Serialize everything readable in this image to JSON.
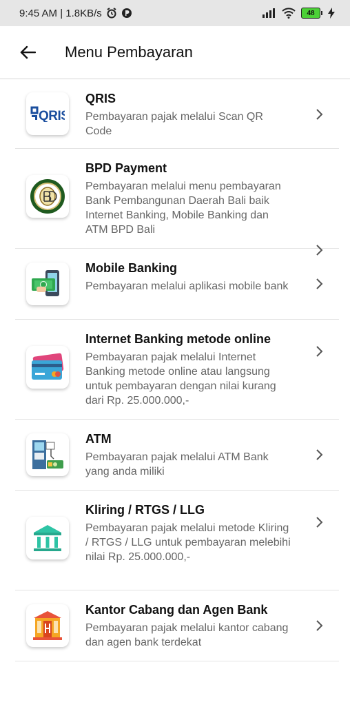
{
  "status_bar": {
    "left_text": "9:45 AM | 1.8KB/s",
    "battery": "48"
  },
  "app_bar": {
    "title": "Menu Pembayaran"
  },
  "items": [
    {
      "title": "QRIS",
      "description": "Pembayaran pajak melalui Scan QR Code",
      "icon": "qris-logo",
      "logo_text": "QRIS"
    },
    {
      "title": "BPD Payment",
      "description": "Pembayaran melalui menu pembayaran Bank Pembangunan Daerah Bali baik Internet Banking, Mobile Banking dan ATM BPD Bali",
      "icon": "bpd-bali-logo"
    },
    {
      "title": "Mobile Banking",
      "description": "Pembayaran melalui aplikasi mobile bank",
      "icon": "mobile-banking-icon"
    },
    {
      "title": "Internet Banking metode online",
      "description": "Pembayaran pajak melalui Internet Banking metode online atau langsung untuk pembayaran dengan nilai kurang dari Rp. 25.000.000,-",
      "icon": "credit-card-icon"
    },
    {
      "title": "ATM",
      "description": "Pembayaran pajak melalui ATM Bank yang anda miliki",
      "icon": "atm-icon"
    },
    {
      "title": "Kliring / RTGS / LLG",
      "description": "Pembayaran pajak melalui metode Kliring / RTGS / LLG untuk pembayaran melebihi nilai Rp. 25.000.000,-",
      "icon": "bank-building-icon"
    },
    {
      "title": "Kantor Cabang dan Agen Bank",
      "description": "Pembayaran pajak melalui kantor cabang dan agen bank terdekat",
      "icon": "bank-office-icon"
    }
  ]
}
